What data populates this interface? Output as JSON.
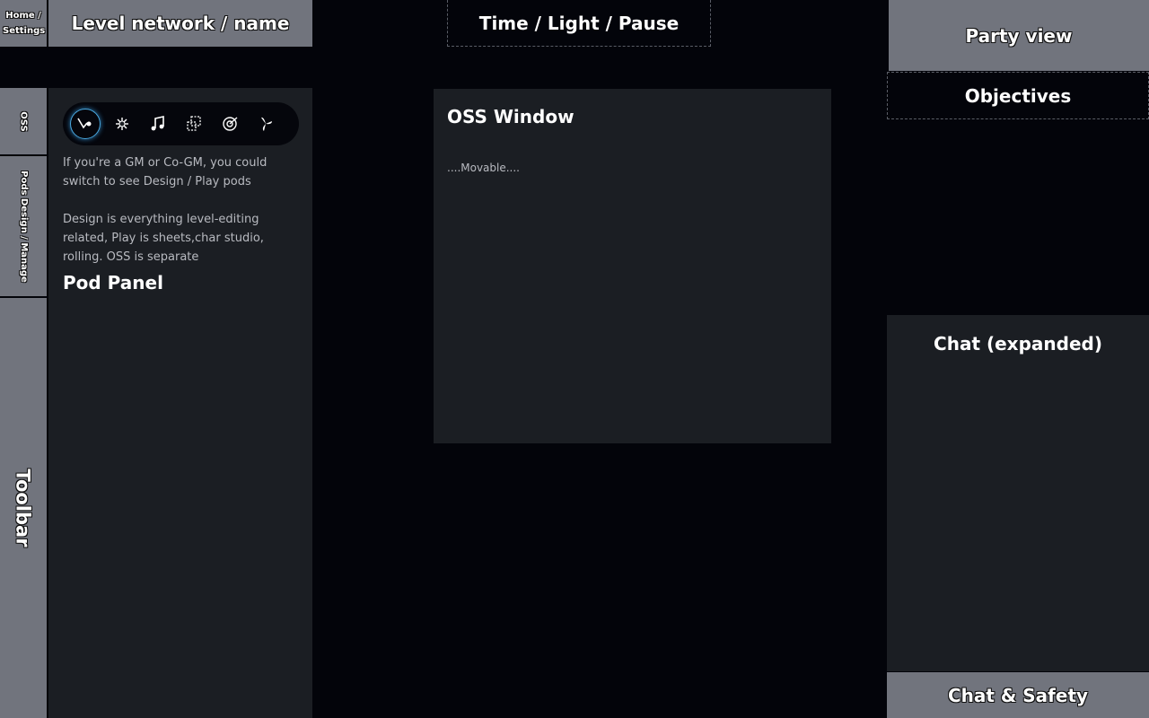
{
  "header": {
    "home_label": "Home / Settings",
    "level_label": "Level network / name",
    "time_label": "Time / Light / Pause"
  },
  "left_tabs": {
    "oss": "OSS",
    "pods": "Pods Design / Manage",
    "toolbar": "Toolbar"
  },
  "pod_panel": {
    "icons": [
      "quill-icon",
      "sparkle-icon",
      "music-icon",
      "dice-icon",
      "target-icon",
      "fan-icon"
    ],
    "active_icon": "quill-icon",
    "text1": "If you're a GM or Co-GM, you could switch to see Design / Play pods",
    "text2": "Design is everything level-editing related, Play is sheets,char studio, rolling. OSS is separate",
    "title": "Pod Panel"
  },
  "oss_window": {
    "title": "OSS Window",
    "movable": "....Movable...."
  },
  "right": {
    "party_view": "Party view",
    "objectives": "Objectives",
    "chat_expanded": "Chat (expanded)",
    "chat_safety": "Chat & Safety"
  },
  "colors": {
    "background": "#03040a",
    "panel": "#1b1e23",
    "tab_grey": "#71747d",
    "accent": "#4aa8e0"
  }
}
